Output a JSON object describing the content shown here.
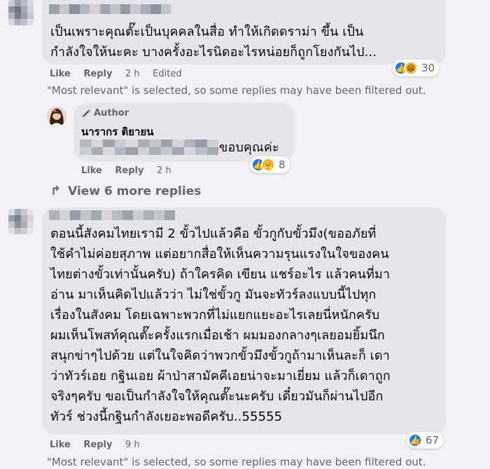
{
  "comment1": {
    "text_line1": "เป็นเพราะคุณตั๊ะเป็นบุคคลในสื่อ ทำให้เกิดดราม่า ขึ้น เป็น",
    "text_line2": "กำลังใจให้นะคะ บางครั้งอะไรนิดอะไรหน่อยก็ถูกโยงกันไป...",
    "like_label": "Like",
    "reply_label": "Reply",
    "time": "2 h",
    "edited_label": "Edited",
    "reaction_count": "30",
    "filter_note": "\"Most relevant\" is selected, so some replies may have been filtered out."
  },
  "reply1": {
    "author_badge": "Author",
    "author_name": "นารากร ติยายน",
    "text": "ขอบคุณค่ะ",
    "like_label": "Like",
    "reply_label": "Reply",
    "time": "2 h",
    "reaction_count": "8"
  },
  "view_more": {
    "label": "View 6 more replies"
  },
  "comment2": {
    "lines": [
      "ตอนนี้สังคมไทยเรามี 2 ขั้วไปแล้วคือ ขั้วกูกับขั้วมึง(ขออภัยที่",
      "ใช้คำไม่ค่อยสุภาพ แต่อยากสื่อให้เห็นความรุนแรงในใจของคน",
      "ไทยต่างขั้วเท่านั้นครับ) ถ้าใครคิด เขียน แชร์อะไร แล้วคนที่มา",
      "อ่าน มาเห็นคิดไปแล้วว่า ไม่ใช่ขั้วกู มันจะทัวร์ลงแบบนี้ไปทุก",
      "เรื่องในสังคม โดยเฉพาะพวกที่ไม่แยกแยะอะไรเลยนี่หนักครับ",
      "ผมเห็นโพสท์คุณตั๊ะครั้งแรกเมื่อเช้า ผมมองกลางๆเลยอมยิ้มนึก",
      "สนุกข่าๆไปด้วย แต่ในใจคิดว่าพวกขั้วมึงขั้วกูถ้ามาเห็นละก็ เดา",
      "ว่าทัวร์เอย กฐินเอย ผ้าป่าสามัคคีเอยน่าจะมาเยี่ยม แล้วก็เดาถูก",
      "จริงๆครับ ขอเป็นกำลังใจให้คุณตั๊ะนะครับ เดี๋ยวมันก็ผ่านไปอีก",
      "ทัวร์ ช่วงนี้กฐินกำลังเยอะพอดีครับ..55555"
    ],
    "like_label": "Like",
    "reply_label": "Reply",
    "time": "9 h",
    "reaction_count": "67",
    "filter_note": "\"Most relevant\" is selected, so some replies may have been filtered out."
  },
  "colors": {
    "background": "#f0f2f5",
    "bubble": "#e4e6eb",
    "meta_text": "#65676b",
    "like_blue": "#1877f2",
    "haha_yellow": "#f7b125"
  },
  "icons": {
    "like": "like-reaction-icon",
    "haha": "haha-reaction-icon",
    "care": "care-reaction-icon",
    "author": "pencil-icon",
    "reply_arrow": "reply-arrow-icon"
  }
}
